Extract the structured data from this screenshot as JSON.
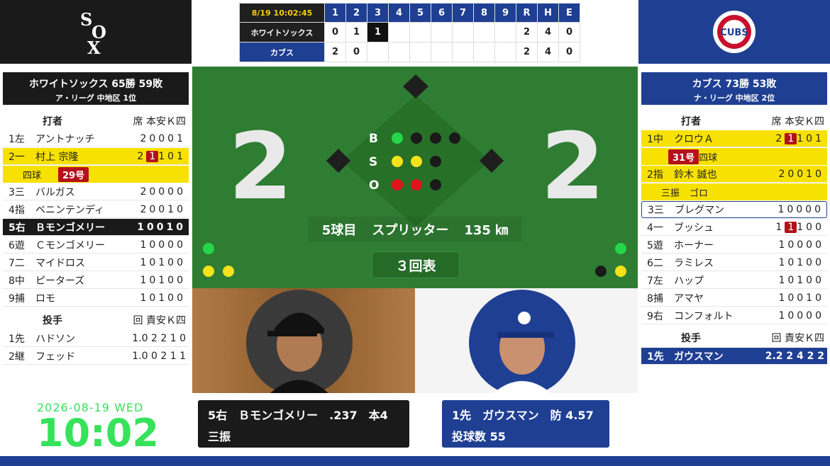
{
  "scoreboard": {
    "time": "8/19 10:02:45",
    "innings": [
      "1",
      "2",
      "3",
      "4",
      "5",
      "6",
      "7",
      "8",
      "9"
    ],
    "rhe_labels": [
      "R",
      "H",
      "E"
    ],
    "away": {
      "name": "ホワイトソックス",
      "runs": [
        "0",
        "1",
        "1",
        "",
        "",
        "",
        "",
        "",
        ""
      ],
      "rhe": [
        "2",
        "4",
        "0"
      ]
    },
    "home": {
      "name": "カブス",
      "runs": [
        "2",
        "0",
        "",
        "",
        "",
        "",
        "",
        "",
        ""
      ],
      "rhe": [
        "2",
        "4",
        "0"
      ]
    }
  },
  "field": {
    "away_score": "2",
    "home_score": "2",
    "labels": {
      "b": "B",
      "s": "S",
      "o": "O"
    },
    "count": {
      "balls": 1,
      "strikes": 2,
      "outs": 2
    },
    "pitch_no": "5球目",
    "pitch_type": "スプリッター",
    "pitch_speed": "135 ㎞",
    "inning": "３回表"
  },
  "away_panel": {
    "title": "ホワイトソックス 65勝 59敗",
    "league": "ア・リーグ 中地区 1位",
    "batter_header": "打者",
    "batter_cols": "席 本安Ｋ四",
    "batters": [
      {
        "pos": "1左",
        "name": "アントナッチ",
        "stats": "20001"
      },
      {
        "pos": "2一",
        "name": "村上 宗隆",
        "stats_a": "2",
        "stats_hl": "1",
        "stats_b": "101"
      },
      {
        "pos": "3三",
        "name": "バルガス",
        "stats": "20000"
      },
      {
        "pos": "4指",
        "name": "ベニンテンディ",
        "stats": "20010"
      },
      {
        "pos": "5右",
        "name": "Ｂモンゴメリー",
        "stats": "10010"
      },
      {
        "pos": "6遊",
        "name": "Ｃモンゴメリー",
        "stats": "10000"
      },
      {
        "pos": "7二",
        "name": "マイドロス",
        "stats": "10100"
      },
      {
        "pos": "8中",
        "name": "ピーターズ",
        "stats": "10100"
      },
      {
        "pos": "9捕",
        "name": "ロモ",
        "stats": "10100"
      }
    ],
    "murakami_sub": {
      "result": "四球",
      "tag": "29号"
    },
    "pitcher_header": "投手",
    "pitcher_cols": "回 責安Ｋ四",
    "pitchers": [
      {
        "pos": "1先",
        "name": "ハドソン",
        "stats": "1.0 2 2 1 0"
      },
      {
        "pos": "2継",
        "name": "フェッド",
        "stats": "1.0 0 2 1 1"
      }
    ]
  },
  "home_panel": {
    "title": "カブス 73勝 53敗",
    "league": "ナ・リーグ 中地区 2位",
    "batter_header": "打者",
    "batter_cols": "席 本安Ｋ四",
    "batters": [
      {
        "pos": "1中",
        "name": "クロウＡ",
        "stats_a": "2",
        "stats_hl": "1",
        "stats_b": "101"
      },
      {
        "pos": "2指",
        "name": "鈴木 誠也",
        "stats": "20010"
      },
      {
        "pos": "3三",
        "name": "ブレグマン",
        "stats": "10000"
      },
      {
        "pos": "4一",
        "name": "ブッシュ",
        "stats_a": "1",
        "stats_hl": "1",
        "stats_b": "100"
      },
      {
        "pos": "5遊",
        "name": "ホーナー",
        "stats": "10000"
      },
      {
        "pos": "6二",
        "name": "ラミレス",
        "stats": "10100"
      },
      {
        "pos": "7左",
        "name": "ハップ",
        "stats": "10100"
      },
      {
        "pos": "8捕",
        "name": "アマヤ",
        "stats": "10010"
      },
      {
        "pos": "9右",
        "name": "コンフォルト",
        "stats": "10000"
      }
    ],
    "crow_sub": {
      "tag": "31号",
      "result": "四球"
    },
    "suzuki_sub": {
      "result1": "三振",
      "result2": "ゴロ"
    },
    "pitcher_header": "投手",
    "pitcher_cols": "回 責安Ｋ四",
    "pitchers": [
      {
        "pos": "1先",
        "name": "ガウスマン",
        "stats": "2.2 2 4 2 2"
      }
    ]
  },
  "batter_info": {
    "line1": "5右　Ｂモンゴメリー　.237　本4",
    "line2": "三振"
  },
  "pitcher_info": {
    "line1": "1先　ガウスマン　防 4.57",
    "line2": "投球数 55"
  },
  "clock": {
    "date": "2026-08-19 WED",
    "time": "10:02"
  },
  "colors": {
    "away": "#1a1a1a",
    "home": "#1f3f93",
    "field": "#2f7d32",
    "highlight": "#f7e100"
  }
}
